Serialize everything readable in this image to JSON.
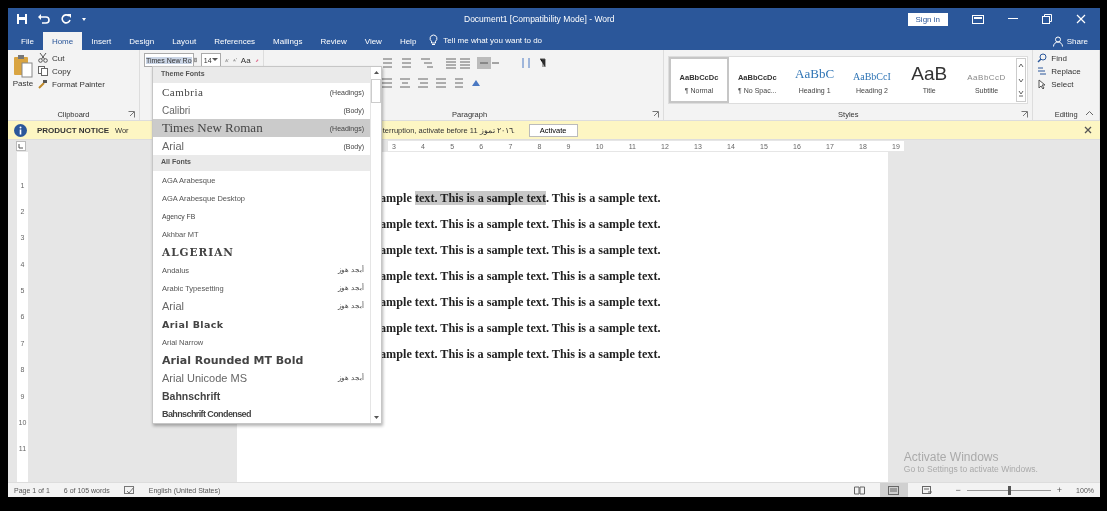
{
  "window": {
    "title": "Document1 [Compatibility Mode]  -  Word",
    "sign_in": "Sign in"
  },
  "tabs": [
    {
      "label": "File",
      "selected": false
    },
    {
      "label": "Home",
      "selected": true
    },
    {
      "label": "Insert",
      "selected": false
    },
    {
      "label": "Design",
      "selected": false
    },
    {
      "label": "Layout",
      "selected": false
    },
    {
      "label": "References",
      "selected": false
    },
    {
      "label": "Mailings",
      "selected": false
    },
    {
      "label": "Review",
      "selected": false
    },
    {
      "label": "View",
      "selected": false
    },
    {
      "label": "Help",
      "selected": false
    }
  ],
  "tell_me": "Tell me what you want to do",
  "share": "Share",
  "clipboard": {
    "paste": "Paste",
    "cut": "Cut",
    "copy": "Copy",
    "format_painter": "Format Painter",
    "label": "Clipboard"
  },
  "font": {
    "name": "Times New Ro",
    "size": "14",
    "change_case": "Aa"
  },
  "paragraph": {
    "label": "Paragraph"
  },
  "styles": {
    "label": "Styles",
    "items": [
      {
        "preview": "AaBbCcDc",
        "name": "¶ Normal",
        "kind": "normal",
        "selected": true
      },
      {
        "preview": "AaBbCcDc",
        "name": "¶ No Spac...",
        "kind": "normal",
        "selected": false
      },
      {
        "preview": "AaBbC",
        "name": "Heading 1",
        "kind": "heading1",
        "selected": false
      },
      {
        "preview": "AaBbCcI",
        "name": "Heading 2",
        "kind": "heading2",
        "selected": false
      },
      {
        "preview": "AaB",
        "name": "Title",
        "kind": "title",
        "selected": false
      },
      {
        "preview": "AaBbCcD",
        "name": "Subtitle",
        "kind": "subtitle",
        "selected": false
      }
    ]
  },
  "editing": {
    "label": "Editing",
    "find": "Find",
    "replace": "Replace",
    "select": "Select"
  },
  "notice": {
    "label": "PRODUCT NOTICE",
    "text_left": "Wor",
    "text_right": "terruption, activate before ٢٠١٦ تموز 11.",
    "button": "Activate"
  },
  "ruler_numbers": [
    "3",
    "4",
    "5",
    "6",
    "7",
    "8",
    "9",
    "10",
    "11",
    "12",
    "13",
    "14",
    "15",
    "16",
    "17",
    "18",
    "19"
  ],
  "vertical_ruler_numbers": [
    "1",
    "2",
    "3",
    "4",
    "5",
    "6",
    "7",
    "8",
    "9",
    "10",
    "11"
  ],
  "font_dropdown": {
    "sections": [
      {
        "header": "Theme Fonts",
        "fonts": [
          {
            "name": "Cambria",
            "note": "(Headings)",
            "kind": "serif",
            "selected": false
          },
          {
            "name": "Calibri",
            "note": "(Body)",
            "kind": "light",
            "selected": false
          },
          {
            "name": "Times New Roman",
            "note": "(Headings)",
            "kind": "serif-large",
            "selected": true
          },
          {
            "name": "Arial",
            "note": "(Body)",
            "kind": "sans",
            "selected": false
          }
        ]
      },
      {
        "header": "All Fonts",
        "fonts": [
          {
            "name": "AGA Arabesque",
            "kind": "small",
            "selected": false
          },
          {
            "name": "AGA Arabesque Desktop",
            "kind": "small",
            "selected": false
          },
          {
            "name": "Agency FB",
            "kind": "narrow",
            "selected": false
          },
          {
            "name": "Akhbar MT",
            "kind": "small",
            "selected": false
          },
          {
            "name": "ALGERIAN",
            "kind": "caps",
            "selected": false
          },
          {
            "name": "Andalus",
            "note": "أبجد هوز",
            "kind": "small",
            "selected": false
          },
          {
            "name": "Arabic Typesetting",
            "note": "أبجد هوز",
            "kind": "small",
            "selected": false
          },
          {
            "name": "Arial",
            "note": "أبجد هوز",
            "kind": "sans",
            "selected": false
          },
          {
            "name": "Arial Black",
            "kind": "black",
            "selected": false
          },
          {
            "name": "Arial Narrow",
            "kind": "small",
            "selected": false
          },
          {
            "name": "Arial Rounded MT Bold",
            "kind": "rounded",
            "selected": false
          },
          {
            "name": "Arial Unicode MS",
            "note": "أبجد هوز",
            "kind": "sans",
            "selected": false
          },
          {
            "name": "Bahnschrift",
            "kind": "semibold",
            "selected": false
          },
          {
            "name": "Bahnschrift Condensed",
            "kind": "condensed",
            "selected": false
          }
        ]
      }
    ]
  },
  "document": {
    "lines": [
      {
        "segments": [
          {
            "text": "ample ",
            "selected": false
          },
          {
            "text": "text. This is a sample text",
            "selected": true
          },
          {
            "text": ". This is a sample text.",
            "selected": false
          }
        ]
      },
      {
        "segments": [
          {
            "text": "ample text. This is a sample text. This is a sample text.",
            "selected": false
          }
        ]
      },
      {
        "segments": [
          {
            "text": "ample text. This is a sample text. This is a sample text.",
            "selected": false
          }
        ]
      },
      {
        "segments": [
          {
            "text": "ample text. This is a sample text. This is a sample text.",
            "selected": false
          }
        ]
      },
      {
        "segments": [
          {
            "text": "ample text. This is a sample text. This is a sample text.",
            "selected": false
          }
        ]
      },
      {
        "segments": [
          {
            "text": "ample text. This is a sample text. This is a sample text.",
            "selected": false
          }
        ]
      },
      {
        "segments": [
          {
            "text": "ample text. This is a sample text. This is a sample text.",
            "selected": false
          }
        ]
      }
    ]
  },
  "activation": {
    "title": "Activate Windows",
    "text": "Go to Settings to activate Windows."
  },
  "status_bar": {
    "page": "Page 1 of 1",
    "words": "6 of 105 words",
    "language": "English (United States)",
    "views": [
      {
        "kind": "read",
        "selected": false
      },
      {
        "kind": "print",
        "selected": true
      },
      {
        "kind": "web",
        "selected": false
      }
    ],
    "zoom": {
      "level": 0.5
    },
    "zoom_out": "−",
    "zoom_in": "+",
    "zoom_label": "100%"
  }
}
